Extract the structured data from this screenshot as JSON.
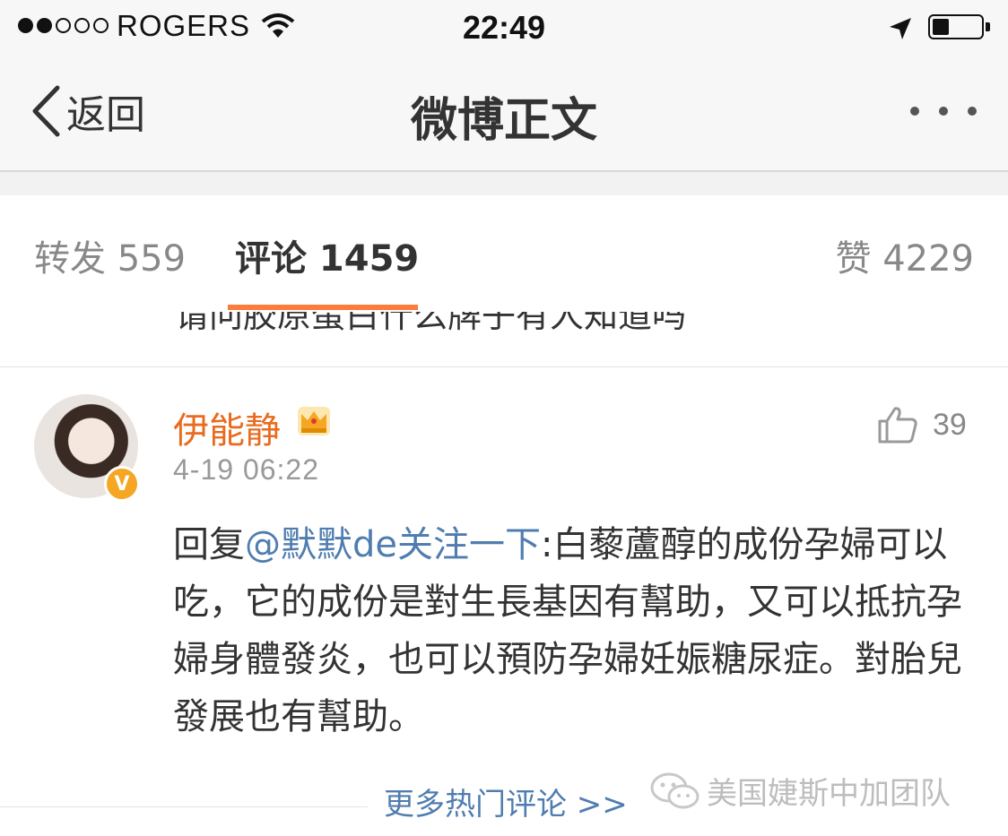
{
  "status_bar": {
    "carrier": "ROGERS",
    "time": "22:49",
    "signal_bars_filled": 2,
    "signal_bars_total": 5,
    "icons": [
      "wifi-icon",
      "location-arrow-icon",
      "battery-icon"
    ]
  },
  "nav": {
    "back_label": "返回",
    "title": "微博正文",
    "more_icon": "more-dots-icon"
  },
  "tabs": [
    {
      "label": "转发 559"
    },
    {
      "label": "评论 1459",
      "active": true
    },
    {
      "label": "赞 4229"
    }
  ],
  "previous_comment": {
    "text": "请问胶原蛋白什么牌子有人知道吗"
  },
  "comment": {
    "username": "伊能静",
    "timestamp": "4-19 06:22",
    "like_count": "39",
    "verified_badge": "V",
    "reply_prefix": "回复",
    "mention": "@默默de关注一下",
    "body": ":白藜蘆醇的成份孕婦可以吃，它的成份是對生長基因有幫助，又可以抵抗孕婦身體發炎，也可以預防孕婦妊娠糖尿症。對胎兒發展也有幫助。"
  },
  "footer": {
    "more_hot_comments": "更多热门评论 >>",
    "watermark": "美国婕斯中加团队"
  },
  "colors": {
    "accent": "#fa7d3c",
    "username": "#e86b1f",
    "link": "#507daf",
    "verified": "#f5a623"
  }
}
